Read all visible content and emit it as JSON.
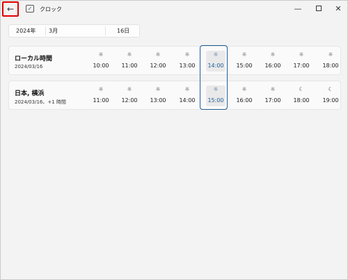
{
  "titlebar": {
    "back_glyph": "←",
    "app_title": "クロック",
    "app_icon": "alarm-clock-icon",
    "minimize_glyph": "—",
    "close_glyph": "✕"
  },
  "datepicker": {
    "year": "2024年",
    "month": "3月",
    "day": "16日"
  },
  "rows": [
    {
      "name": "ローカル時間",
      "subtitle": "2024/03/16",
      "hours": [
        {
          "time": "10:00",
          "icon": "sun-icon"
        },
        {
          "time": "11:00",
          "icon": "sun-icon"
        },
        {
          "time": "12:00",
          "icon": "sun-icon"
        },
        {
          "time": "13:00",
          "icon": "sun-icon"
        },
        {
          "time": "14:00",
          "icon": "sun-icon",
          "current": true
        },
        {
          "time": "15:00",
          "icon": "sun-icon"
        },
        {
          "time": "16:00",
          "icon": "sun-icon"
        },
        {
          "time": "17:00",
          "icon": "sun-icon"
        },
        {
          "time": "18:00",
          "icon": "sun-icon"
        }
      ]
    },
    {
      "name": "日本, 横浜",
      "subtitle": "2024/03/16、+1 時間",
      "hours": [
        {
          "time": "11:00",
          "icon": "sun-icon"
        },
        {
          "time": "12:00",
          "icon": "sun-icon"
        },
        {
          "time": "13:00",
          "icon": "sun-icon"
        },
        {
          "time": "14:00",
          "icon": "sun-icon"
        },
        {
          "time": "15:00",
          "icon": "sun-icon",
          "current": true
        },
        {
          "time": "16:00",
          "icon": "sun-icon"
        },
        {
          "time": "17:00",
          "icon": "sun-icon"
        },
        {
          "time": "18:00",
          "icon": "moon-icon"
        },
        {
          "time": "19:00",
          "icon": "moon-icon"
        }
      ]
    }
  ],
  "accent_color": "#1f5e96"
}
